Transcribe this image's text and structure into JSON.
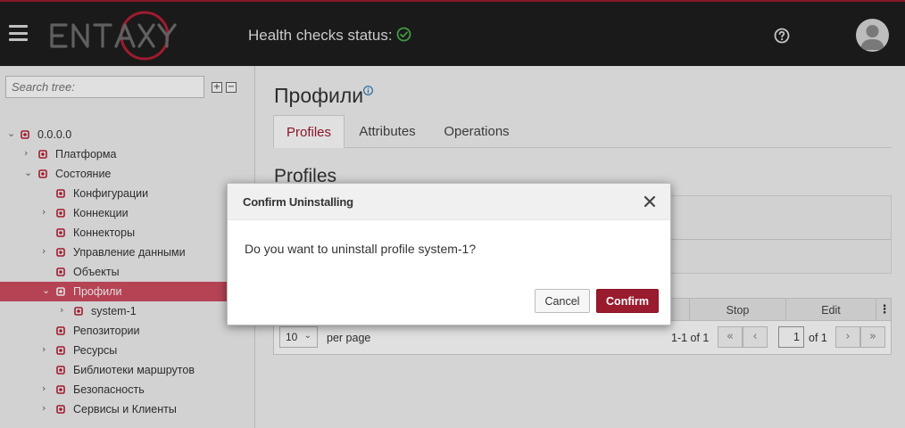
{
  "header": {
    "logo_text": "ENTAXY",
    "health_label": "Health checks status:",
    "health_icon": "check-circle-icon",
    "help_icon": "question-circle-icon",
    "avatar_icon": "user-avatar-icon"
  },
  "sidebar": {
    "search_placeholder": "Search tree:",
    "expand_all_icon": "plus-square-icon",
    "collapse_all_icon": "minus-square-icon",
    "tree": [
      {
        "label": "0.0.0.0",
        "caret": "⌄",
        "icon": "cluster-icon"
      },
      {
        "label": "Платформа",
        "caret": "›",
        "icon": "platform-icon"
      },
      {
        "label": "Состояние",
        "caret": "⌄",
        "icon": "state-icon"
      },
      {
        "label": "Конфигурации",
        "caret": "",
        "icon": "config-gear-icon"
      },
      {
        "label": "Коннекции",
        "caret": "›",
        "icon": "connections-icon"
      },
      {
        "label": "Коннекторы",
        "caret": "",
        "icon": "connectors-icon"
      },
      {
        "label": "Управление данными",
        "caret": "›",
        "icon": "data-management-icon"
      },
      {
        "label": "Объекты",
        "caret": "",
        "icon": "objects-icon"
      },
      {
        "label": "Профили",
        "caret": "⌄",
        "icon": "profiles-icon"
      },
      {
        "label": "system-1",
        "caret": "›",
        "icon": "profile-item-icon"
      },
      {
        "label": "Репозитории",
        "caret": "",
        "icon": "repository-icon"
      },
      {
        "label": "Ресурсы",
        "caret": "›",
        "icon": "resources-icon"
      },
      {
        "label": "Библиотеки маршрутов",
        "caret": "",
        "icon": "route-library-icon"
      },
      {
        "label": "Безопасность",
        "caret": "›",
        "icon": "security-icon"
      },
      {
        "label": "Сервисы и Клиенты",
        "caret": "›",
        "icon": "services-clients-icon"
      }
    ]
  },
  "main": {
    "page_title": "Профили",
    "info_icon": "info-circle-icon",
    "tabs": [
      {
        "label": "Profiles"
      },
      {
        "label": "Attributes"
      },
      {
        "label": "Operations"
      }
    ],
    "section_title": "Profiles",
    "grid_columns": [
      {
        "label": "Stop"
      },
      {
        "label": "Edit"
      }
    ],
    "column_menu_glyph": "⋮",
    "pager": {
      "page_size": "10",
      "per_page_label": "per page",
      "range": "1-1 of 1",
      "first_glyph": "«",
      "prev_glyph": "‹",
      "current_page": "1",
      "of_pages": "of 1",
      "next_glyph": "›",
      "last_glyph": "»"
    }
  },
  "modal": {
    "title": "Confirm Uninstalling",
    "close_icon": "close-x-icon",
    "message": "Do you want to uninstall profile system-1?",
    "cancel_label": "Cancel",
    "confirm_label": "Confirm"
  },
  "colors": {
    "brand": "#9a1b2e",
    "header_bg": "#1e1e1e",
    "selected_row": "#cf4d60",
    "health_ok": "#4caf50",
    "info_blue": "#2a7ab8"
  }
}
